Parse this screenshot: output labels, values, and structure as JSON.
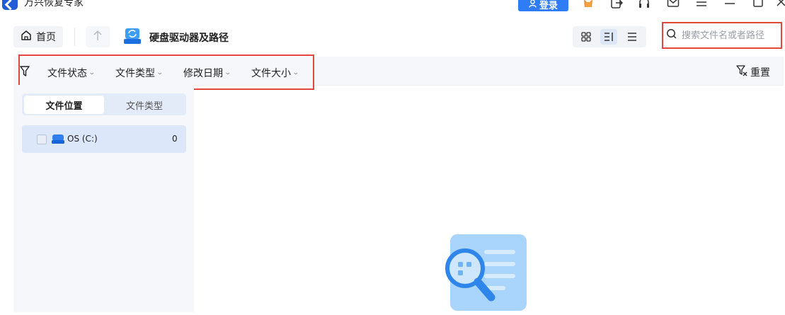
{
  "app": {
    "title": "万兴恢复专家",
    "login_label": "登录"
  },
  "titlebar_icons": [
    "gift-icon",
    "export-icon",
    "headset-icon",
    "mail-icon",
    "menu-icon",
    "minimize-icon",
    "maximize-icon",
    "close-icon"
  ],
  "toolbar": {
    "home_label": "首页",
    "location_title": "硬盘驱动器及路径",
    "view_modes": [
      "grid-view-icon",
      "detail-view-icon",
      "list-view-icon"
    ],
    "active_view": "detail-view-icon"
  },
  "search": {
    "placeholder": "搜索文件名或者路径",
    "value": ""
  },
  "filters": {
    "items": [
      {
        "label": "文件状态"
      },
      {
        "label": "文件类型"
      },
      {
        "label": "修改日期"
      },
      {
        "label": "文件大小"
      }
    ],
    "reset_label": "重置"
  },
  "sidebar": {
    "tabs": [
      {
        "label": "文件位置",
        "active": true
      },
      {
        "label": "文件类型",
        "active": false
      }
    ],
    "drives": [
      {
        "label": "OS (C:)",
        "count": "0",
        "checked": false
      }
    ]
  },
  "colors": {
    "accent": "#2e7cf6",
    "highlight_border": "#e3473f",
    "panel_bg": "#f5f7fb",
    "selected_row": "#dce7f9"
  }
}
